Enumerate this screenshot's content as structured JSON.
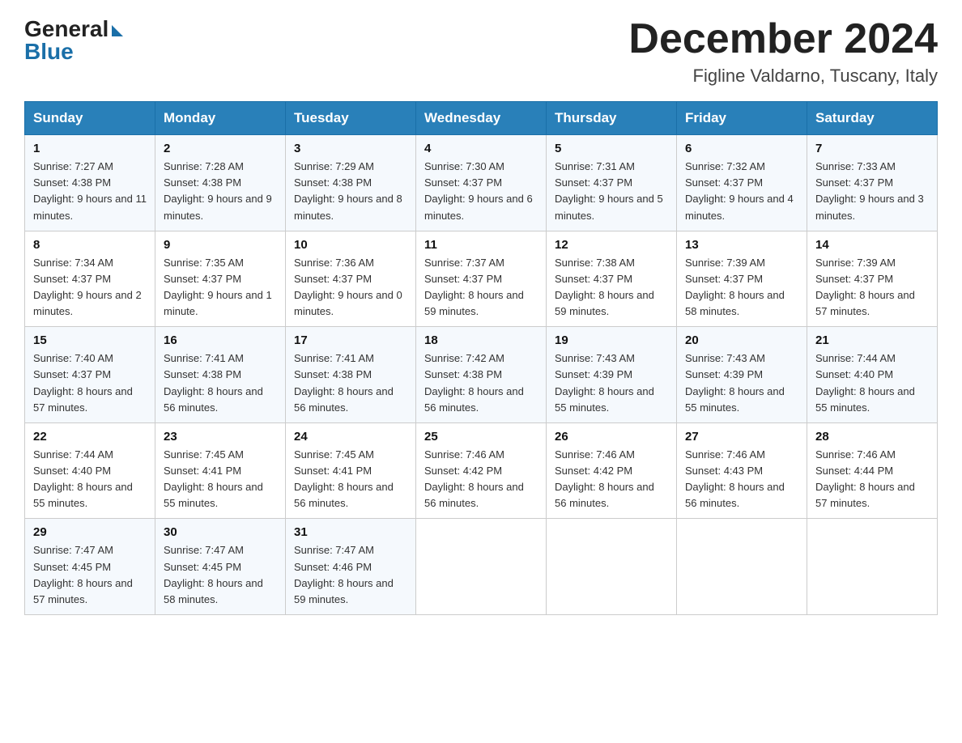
{
  "header": {
    "logo_general": "General",
    "logo_blue": "Blue",
    "month_title": "December 2024",
    "location": "Figline Valdarno, Tuscany, Italy"
  },
  "days_of_week": [
    "Sunday",
    "Monday",
    "Tuesday",
    "Wednesday",
    "Thursday",
    "Friday",
    "Saturday"
  ],
  "weeks": [
    [
      {
        "day": "1",
        "sunrise": "7:27 AM",
        "sunset": "4:38 PM",
        "daylight": "9 hours and 11 minutes."
      },
      {
        "day": "2",
        "sunrise": "7:28 AM",
        "sunset": "4:38 PM",
        "daylight": "9 hours and 9 minutes."
      },
      {
        "day": "3",
        "sunrise": "7:29 AM",
        "sunset": "4:38 PM",
        "daylight": "9 hours and 8 minutes."
      },
      {
        "day": "4",
        "sunrise": "7:30 AM",
        "sunset": "4:37 PM",
        "daylight": "9 hours and 6 minutes."
      },
      {
        "day": "5",
        "sunrise": "7:31 AM",
        "sunset": "4:37 PM",
        "daylight": "9 hours and 5 minutes."
      },
      {
        "day": "6",
        "sunrise": "7:32 AM",
        "sunset": "4:37 PM",
        "daylight": "9 hours and 4 minutes."
      },
      {
        "day": "7",
        "sunrise": "7:33 AM",
        "sunset": "4:37 PM",
        "daylight": "9 hours and 3 minutes."
      }
    ],
    [
      {
        "day": "8",
        "sunrise": "7:34 AM",
        "sunset": "4:37 PM",
        "daylight": "9 hours and 2 minutes."
      },
      {
        "day": "9",
        "sunrise": "7:35 AM",
        "sunset": "4:37 PM",
        "daylight": "9 hours and 1 minute."
      },
      {
        "day": "10",
        "sunrise": "7:36 AM",
        "sunset": "4:37 PM",
        "daylight": "9 hours and 0 minutes."
      },
      {
        "day": "11",
        "sunrise": "7:37 AM",
        "sunset": "4:37 PM",
        "daylight": "8 hours and 59 minutes."
      },
      {
        "day": "12",
        "sunrise": "7:38 AM",
        "sunset": "4:37 PM",
        "daylight": "8 hours and 59 minutes."
      },
      {
        "day": "13",
        "sunrise": "7:39 AM",
        "sunset": "4:37 PM",
        "daylight": "8 hours and 58 minutes."
      },
      {
        "day": "14",
        "sunrise": "7:39 AM",
        "sunset": "4:37 PM",
        "daylight": "8 hours and 57 minutes."
      }
    ],
    [
      {
        "day": "15",
        "sunrise": "7:40 AM",
        "sunset": "4:37 PM",
        "daylight": "8 hours and 57 minutes."
      },
      {
        "day": "16",
        "sunrise": "7:41 AM",
        "sunset": "4:38 PM",
        "daylight": "8 hours and 56 minutes."
      },
      {
        "day": "17",
        "sunrise": "7:41 AM",
        "sunset": "4:38 PM",
        "daylight": "8 hours and 56 minutes."
      },
      {
        "day": "18",
        "sunrise": "7:42 AM",
        "sunset": "4:38 PM",
        "daylight": "8 hours and 56 minutes."
      },
      {
        "day": "19",
        "sunrise": "7:43 AM",
        "sunset": "4:39 PM",
        "daylight": "8 hours and 55 minutes."
      },
      {
        "day": "20",
        "sunrise": "7:43 AM",
        "sunset": "4:39 PM",
        "daylight": "8 hours and 55 minutes."
      },
      {
        "day": "21",
        "sunrise": "7:44 AM",
        "sunset": "4:40 PM",
        "daylight": "8 hours and 55 minutes."
      }
    ],
    [
      {
        "day": "22",
        "sunrise": "7:44 AM",
        "sunset": "4:40 PM",
        "daylight": "8 hours and 55 minutes."
      },
      {
        "day": "23",
        "sunrise": "7:45 AM",
        "sunset": "4:41 PM",
        "daylight": "8 hours and 55 minutes."
      },
      {
        "day": "24",
        "sunrise": "7:45 AM",
        "sunset": "4:41 PM",
        "daylight": "8 hours and 56 minutes."
      },
      {
        "day": "25",
        "sunrise": "7:46 AM",
        "sunset": "4:42 PM",
        "daylight": "8 hours and 56 minutes."
      },
      {
        "day": "26",
        "sunrise": "7:46 AM",
        "sunset": "4:42 PM",
        "daylight": "8 hours and 56 minutes."
      },
      {
        "day": "27",
        "sunrise": "7:46 AM",
        "sunset": "4:43 PM",
        "daylight": "8 hours and 56 minutes."
      },
      {
        "day": "28",
        "sunrise": "7:46 AM",
        "sunset": "4:44 PM",
        "daylight": "8 hours and 57 minutes."
      }
    ],
    [
      {
        "day": "29",
        "sunrise": "7:47 AM",
        "sunset": "4:45 PM",
        "daylight": "8 hours and 57 minutes."
      },
      {
        "day": "30",
        "sunrise": "7:47 AM",
        "sunset": "4:45 PM",
        "daylight": "8 hours and 58 minutes."
      },
      {
        "day": "31",
        "sunrise": "7:47 AM",
        "sunset": "4:46 PM",
        "daylight": "8 hours and 59 minutes."
      },
      null,
      null,
      null,
      null
    ]
  ]
}
